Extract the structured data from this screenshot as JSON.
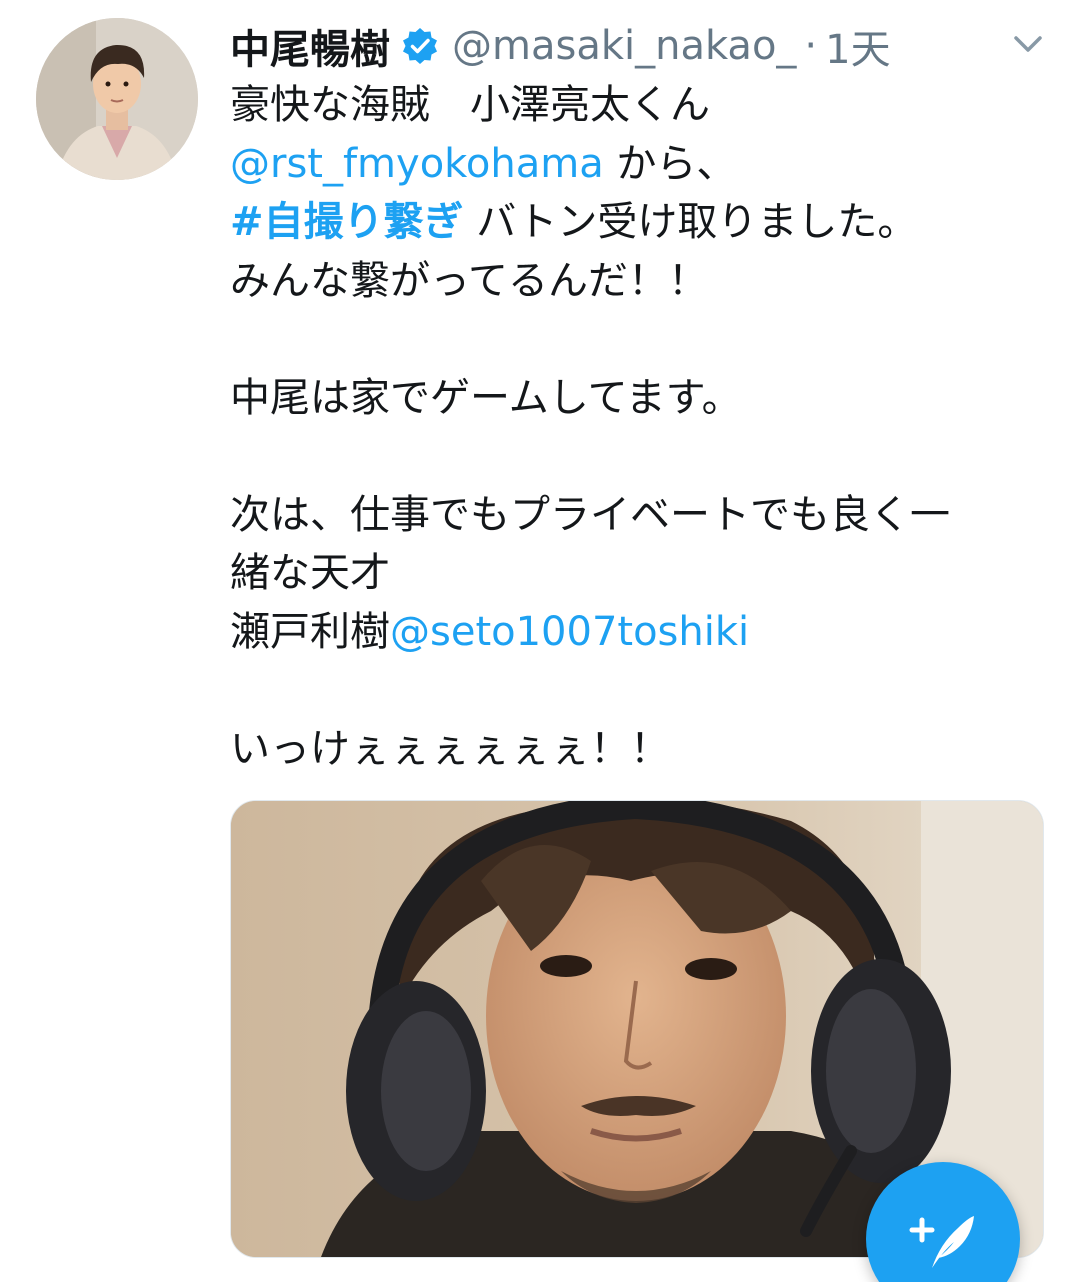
{
  "tweet": {
    "author": {
      "display_name": "中尾暢樹",
      "handle": "@masaki_nakao_",
      "verified": true,
      "avatar_icon": "profile-photo"
    },
    "separator": "·",
    "time": "1天",
    "menu_icon": "chevron-down-icon",
    "text": {
      "line1": "豪快な海賊　小澤亮太くん",
      "line2_mention": "@rst_fmyokohama",
      "line2_rest": " から、",
      "line3_hashtag": "#自撮り繋ぎ",
      "line3_rest": " バトン受け取りました。",
      "line4": "みんな繋がってるんだ！！",
      "line5": "中尾は家でゲームしてます。",
      "line6": "次は、仕事でもプライベートでも良く一",
      "line7": "緒な天才",
      "line8_name": "瀬戸利樹",
      "line8_mention": "@seto1007toshiki",
      "line9": "いっけぇぇぇぇぇぇ！！"
    },
    "media": {
      "type": "photo",
      "description_icon": "selfie-with-headphones"
    }
  },
  "compose_button": {
    "icon": "compose-feather-icon",
    "color": "#1da1f2"
  },
  "colors": {
    "accent": "#1da1f2",
    "text": "#14171a",
    "secondary": "#657786"
  }
}
